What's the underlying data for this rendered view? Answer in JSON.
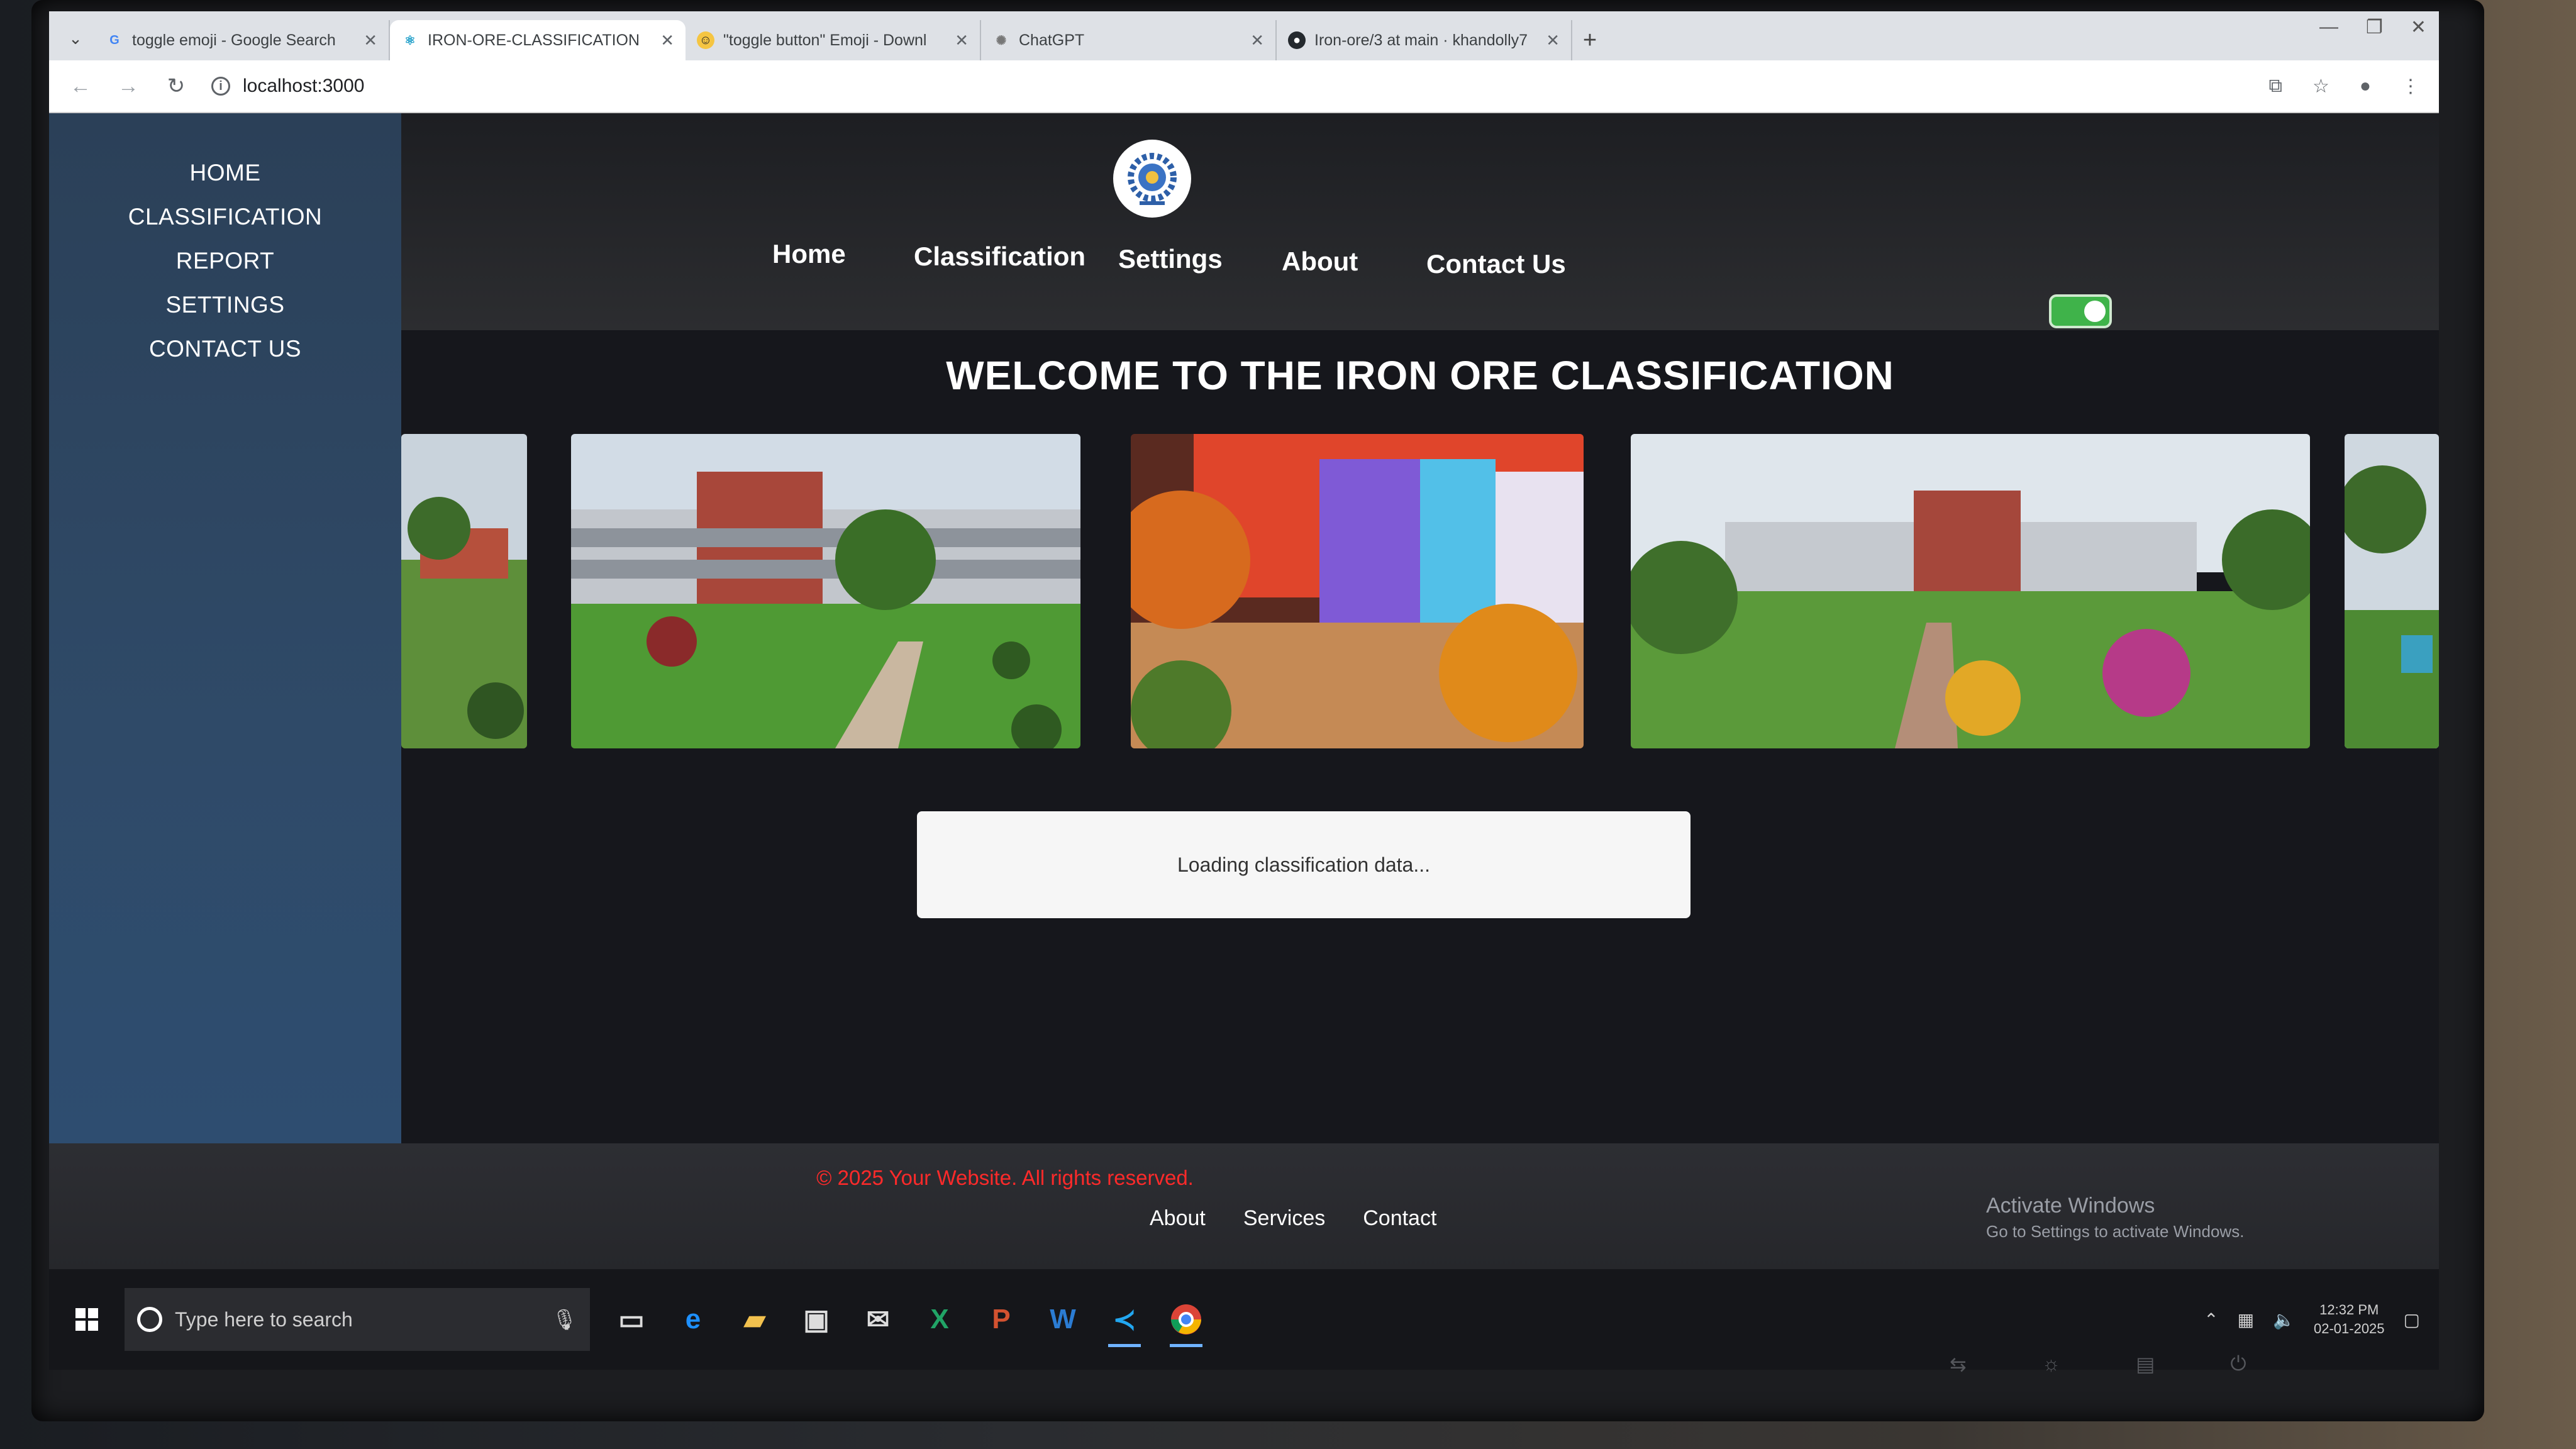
{
  "browser": {
    "tabs": [
      {
        "label": "toggle emoji - Google Search",
        "favicon": "google-icon",
        "color": "#4285f4"
      },
      {
        "label": "IRON-ORE-CLASSIFICATION",
        "favicon": "react-icon",
        "color": "#61dafb"
      },
      {
        "label": "\"toggle button\" Emoji - Downl",
        "favicon": "emoji-icon",
        "color": "#f5c542"
      },
      {
        "label": "ChatGPT",
        "favicon": "chatgpt-icon",
        "color": "#777777"
      },
      {
        "label": "Iron-ore/3 at main · khandolly7",
        "favicon": "github-icon",
        "color": "#24292e"
      }
    ],
    "active_tab": 1,
    "new_tab": "+",
    "url": "localhost:3000"
  },
  "sidebar": {
    "items": [
      "HOME",
      "CLASSIFICATION",
      "REPORT",
      "SETTINGS",
      "CONTACT US"
    ]
  },
  "topnav": {
    "items": [
      "Home",
      "Classification",
      "Settings",
      "About",
      "Contact Us"
    ],
    "toggle_on": true,
    "toggle_color": "#3fb34a"
  },
  "main": {
    "welcome": "WELCOME TO THE IRON ORE CLASSIFICATION",
    "loading": "Loading classification data..."
  },
  "footer": {
    "copyright": "© 2025 Your Website. All rights reserved.",
    "copyright_color": "#ff2a2a",
    "links": [
      "About",
      "Services",
      "Contact"
    ],
    "activate_title": "Activate Windows",
    "activate_sub": "Go to Settings to activate Windows."
  },
  "taskbar": {
    "search_placeholder": "Type here to search",
    "time": "12:32 PM",
    "date": "02-01-2025"
  }
}
